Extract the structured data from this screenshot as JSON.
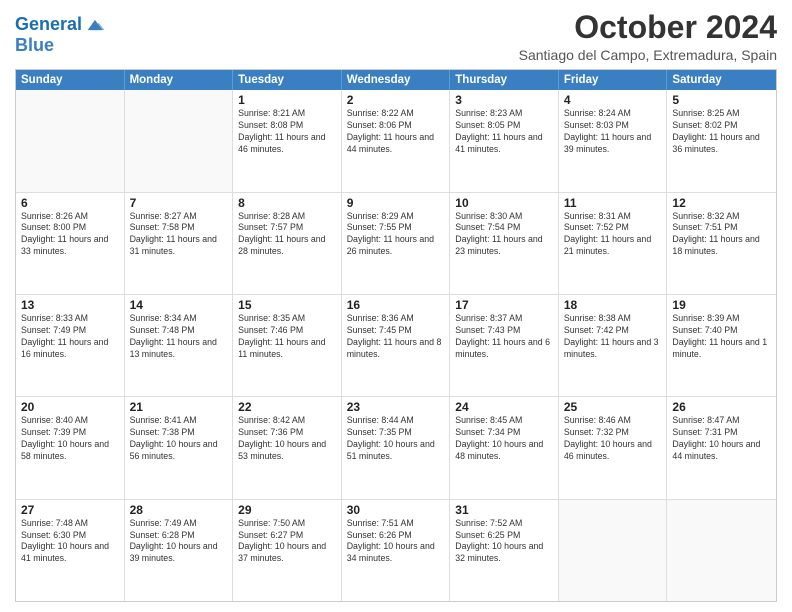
{
  "logo": {
    "line1": "General",
    "line2": "Blue"
  },
  "title": "October 2024",
  "subtitle": "Santiago del Campo, Extremadura, Spain",
  "days": [
    "Sunday",
    "Monday",
    "Tuesday",
    "Wednesday",
    "Thursday",
    "Friday",
    "Saturday"
  ],
  "rows": [
    [
      {
        "day": "",
        "info": ""
      },
      {
        "day": "",
        "info": ""
      },
      {
        "day": "1",
        "info": "Sunrise: 8:21 AM\nSunset: 8:08 PM\nDaylight: 11 hours and 46 minutes."
      },
      {
        "day": "2",
        "info": "Sunrise: 8:22 AM\nSunset: 8:06 PM\nDaylight: 11 hours and 44 minutes."
      },
      {
        "day": "3",
        "info": "Sunrise: 8:23 AM\nSunset: 8:05 PM\nDaylight: 11 hours and 41 minutes."
      },
      {
        "day": "4",
        "info": "Sunrise: 8:24 AM\nSunset: 8:03 PM\nDaylight: 11 hours and 39 minutes."
      },
      {
        "day": "5",
        "info": "Sunrise: 8:25 AM\nSunset: 8:02 PM\nDaylight: 11 hours and 36 minutes."
      }
    ],
    [
      {
        "day": "6",
        "info": "Sunrise: 8:26 AM\nSunset: 8:00 PM\nDaylight: 11 hours and 33 minutes."
      },
      {
        "day": "7",
        "info": "Sunrise: 8:27 AM\nSunset: 7:58 PM\nDaylight: 11 hours and 31 minutes."
      },
      {
        "day": "8",
        "info": "Sunrise: 8:28 AM\nSunset: 7:57 PM\nDaylight: 11 hours and 28 minutes."
      },
      {
        "day": "9",
        "info": "Sunrise: 8:29 AM\nSunset: 7:55 PM\nDaylight: 11 hours and 26 minutes."
      },
      {
        "day": "10",
        "info": "Sunrise: 8:30 AM\nSunset: 7:54 PM\nDaylight: 11 hours and 23 minutes."
      },
      {
        "day": "11",
        "info": "Sunrise: 8:31 AM\nSunset: 7:52 PM\nDaylight: 11 hours and 21 minutes."
      },
      {
        "day": "12",
        "info": "Sunrise: 8:32 AM\nSunset: 7:51 PM\nDaylight: 11 hours and 18 minutes."
      }
    ],
    [
      {
        "day": "13",
        "info": "Sunrise: 8:33 AM\nSunset: 7:49 PM\nDaylight: 11 hours and 16 minutes."
      },
      {
        "day": "14",
        "info": "Sunrise: 8:34 AM\nSunset: 7:48 PM\nDaylight: 11 hours and 13 minutes."
      },
      {
        "day": "15",
        "info": "Sunrise: 8:35 AM\nSunset: 7:46 PM\nDaylight: 11 hours and 11 minutes."
      },
      {
        "day": "16",
        "info": "Sunrise: 8:36 AM\nSunset: 7:45 PM\nDaylight: 11 hours and 8 minutes."
      },
      {
        "day": "17",
        "info": "Sunrise: 8:37 AM\nSunset: 7:43 PM\nDaylight: 11 hours and 6 minutes."
      },
      {
        "day": "18",
        "info": "Sunrise: 8:38 AM\nSunset: 7:42 PM\nDaylight: 11 hours and 3 minutes."
      },
      {
        "day": "19",
        "info": "Sunrise: 8:39 AM\nSunset: 7:40 PM\nDaylight: 11 hours and 1 minute."
      }
    ],
    [
      {
        "day": "20",
        "info": "Sunrise: 8:40 AM\nSunset: 7:39 PM\nDaylight: 10 hours and 58 minutes."
      },
      {
        "day": "21",
        "info": "Sunrise: 8:41 AM\nSunset: 7:38 PM\nDaylight: 10 hours and 56 minutes."
      },
      {
        "day": "22",
        "info": "Sunrise: 8:42 AM\nSunset: 7:36 PM\nDaylight: 10 hours and 53 minutes."
      },
      {
        "day": "23",
        "info": "Sunrise: 8:44 AM\nSunset: 7:35 PM\nDaylight: 10 hours and 51 minutes."
      },
      {
        "day": "24",
        "info": "Sunrise: 8:45 AM\nSunset: 7:34 PM\nDaylight: 10 hours and 48 minutes."
      },
      {
        "day": "25",
        "info": "Sunrise: 8:46 AM\nSunset: 7:32 PM\nDaylight: 10 hours and 46 minutes."
      },
      {
        "day": "26",
        "info": "Sunrise: 8:47 AM\nSunset: 7:31 PM\nDaylight: 10 hours and 44 minutes."
      }
    ],
    [
      {
        "day": "27",
        "info": "Sunrise: 7:48 AM\nSunset: 6:30 PM\nDaylight: 10 hours and 41 minutes."
      },
      {
        "day": "28",
        "info": "Sunrise: 7:49 AM\nSunset: 6:28 PM\nDaylight: 10 hours and 39 minutes."
      },
      {
        "day": "29",
        "info": "Sunrise: 7:50 AM\nSunset: 6:27 PM\nDaylight: 10 hours and 37 minutes."
      },
      {
        "day": "30",
        "info": "Sunrise: 7:51 AM\nSunset: 6:26 PM\nDaylight: 10 hours and 34 minutes."
      },
      {
        "day": "31",
        "info": "Sunrise: 7:52 AM\nSunset: 6:25 PM\nDaylight: 10 hours and 32 minutes."
      },
      {
        "day": "",
        "info": ""
      },
      {
        "day": "",
        "info": ""
      }
    ]
  ]
}
